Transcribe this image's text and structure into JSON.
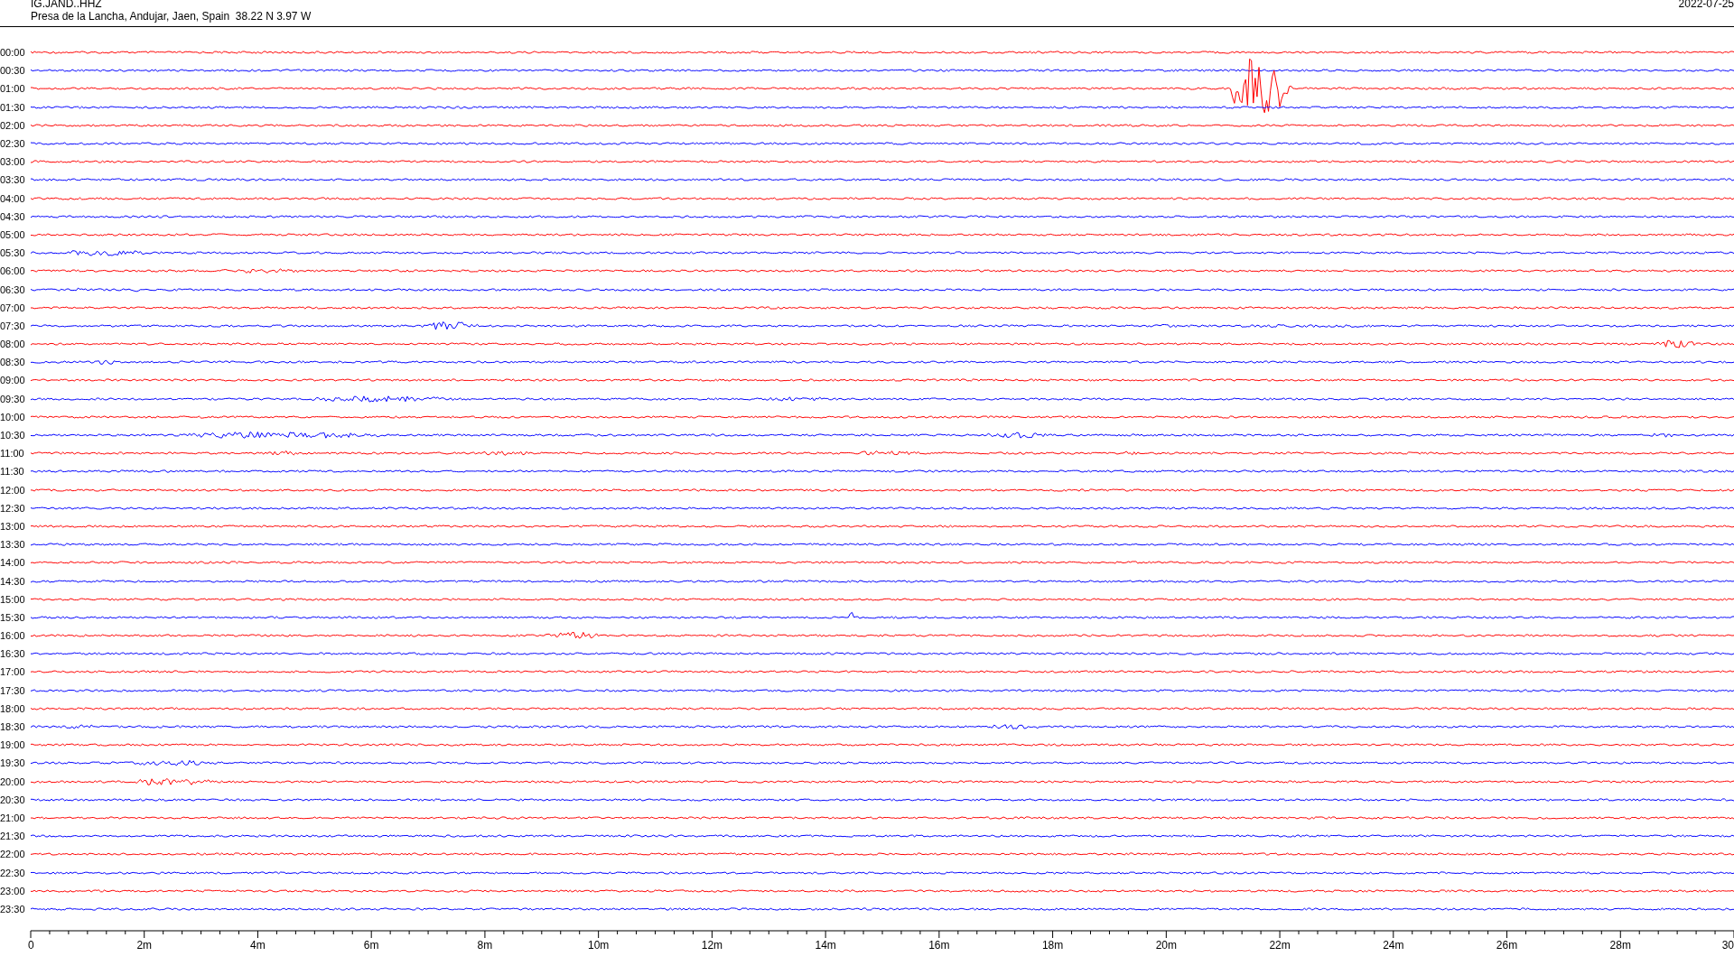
{
  "header": {
    "station": "IG.JAND..HHZ",
    "location": "Presa de la Lancha, Andujar, Jaen, Spain  38.22 N 3.97 W",
    "date": "2022-07-25"
  },
  "rows": [
    {
      "time": "00:00",
      "color": "#ff0000"
    },
    {
      "time": "00:30",
      "color": "#0000ff"
    },
    {
      "time": "01:00",
      "color": "#ff0000"
    },
    {
      "time": "01:30",
      "color": "#0000ff"
    },
    {
      "time": "02:00",
      "color": "#ff0000"
    },
    {
      "time": "02:30",
      "color": "#0000ff"
    },
    {
      "time": "03:00",
      "color": "#ff0000"
    },
    {
      "time": "03:30",
      "color": "#0000ff"
    },
    {
      "time": "04:00",
      "color": "#ff0000"
    },
    {
      "time": "04:30",
      "color": "#0000ff"
    },
    {
      "time": "05:00",
      "color": "#ff0000"
    },
    {
      "time": "05:30",
      "color": "#0000ff"
    },
    {
      "time": "06:00",
      "color": "#ff0000"
    },
    {
      "time": "06:30",
      "color": "#0000ff"
    },
    {
      "time": "07:00",
      "color": "#ff0000"
    },
    {
      "time": "07:30",
      "color": "#0000ff"
    },
    {
      "time": "08:00",
      "color": "#ff0000"
    },
    {
      "time": "08:30",
      "color": "#0000ff"
    },
    {
      "time": "09:00",
      "color": "#ff0000"
    },
    {
      "time": "09:30",
      "color": "#0000ff"
    },
    {
      "time": "10:00",
      "color": "#ff0000"
    },
    {
      "time": "10:30",
      "color": "#0000ff"
    },
    {
      "time": "11:00",
      "color": "#ff0000"
    },
    {
      "time": "11:30",
      "color": "#0000ff"
    },
    {
      "time": "12:00",
      "color": "#ff0000"
    },
    {
      "time": "12:30",
      "color": "#0000ff"
    },
    {
      "time": "13:00",
      "color": "#ff0000"
    },
    {
      "time": "13:30",
      "color": "#0000ff"
    },
    {
      "time": "14:00",
      "color": "#ff0000"
    },
    {
      "time": "14:30",
      "color": "#0000ff"
    },
    {
      "time": "15:00",
      "color": "#ff0000"
    },
    {
      "time": "15:30",
      "color": "#0000ff"
    },
    {
      "time": "16:00",
      "color": "#ff0000"
    },
    {
      "time": "16:30",
      "color": "#0000ff"
    },
    {
      "time": "17:00",
      "color": "#ff0000"
    },
    {
      "time": "17:30",
      "color": "#0000ff"
    },
    {
      "time": "18:00",
      "color": "#ff0000"
    },
    {
      "time": "18:30",
      "color": "#0000ff"
    },
    {
      "time": "19:00",
      "color": "#ff0000"
    },
    {
      "time": "19:30",
      "color": "#0000ff"
    },
    {
      "time": "20:00",
      "color": "#ff0000"
    },
    {
      "time": "20:30",
      "color": "#0000ff"
    },
    {
      "time": "21:00",
      "color": "#ff0000"
    },
    {
      "time": "21:30",
      "color": "#0000ff"
    },
    {
      "time": "22:00",
      "color": "#ff0000"
    },
    {
      "time": "22:30",
      "color": "#0000ff"
    },
    {
      "time": "23:00",
      "color": "#ff0000"
    },
    {
      "time": "23:30",
      "color": "#0000ff"
    }
  ],
  "x_axis": {
    "labels": [
      "0",
      "2m",
      "4m",
      "6m",
      "8m",
      "10m",
      "12m",
      "14m",
      "16m",
      "18m",
      "20m",
      "22m",
      "24m",
      "26m",
      "28m",
      "30"
    ]
  }
}
